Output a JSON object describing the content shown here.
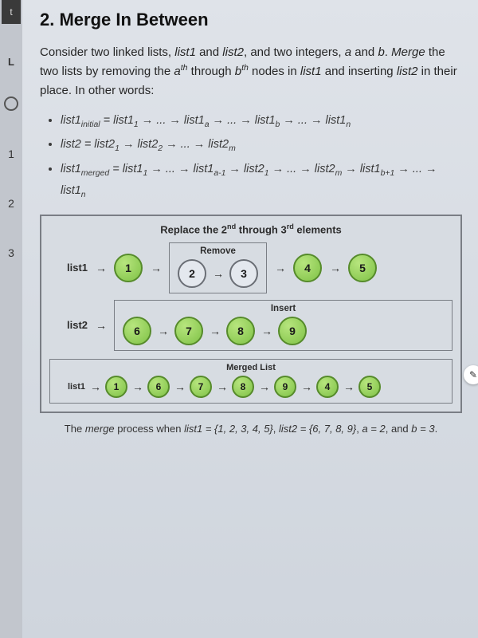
{
  "rail": {
    "tab": "t",
    "item_l": "L",
    "num1": "1",
    "num2": "2",
    "num3": "3"
  },
  "title": "2. Merge In Between",
  "intro": {
    "p1a": "Consider two linked lists, ",
    "list1": "list1",
    "p1b": " and ",
    "list2": "list2",
    "p1c": ", and two integers, ",
    "a": "a",
    "p1d": " and ",
    "b": "b",
    "p1e": ". ",
    "merge": "Merge",
    "p1f": " the two lists by removing the ",
    "ath": "a",
    "th1": "th",
    "p1g": " through ",
    "bth": "b",
    "th2": "th",
    "p1h": " nodes in ",
    "p1i": " and inserting ",
    "p1j": " in their place. In other words:"
  },
  "bullets": {
    "b1": "list1ᵢₙᵢₜᵢₐₗ = list1₁ → ... → list1ₐ → ... → list1_b → ... → list1ₙ",
    "b2": "list2 = list2₁ → list2₂ → ... → list2ₘ",
    "b3": "list1ₘₑᵣgₑd = list1₁ → ... → list1ₐ₋₁ → list2₁ → ... → list2ₘ → list1_b₊₁ → ... → list1ₙ"
  },
  "diagram": {
    "title_a": "Replace the 2",
    "title_nd": "nd",
    "title_b": " through 3",
    "title_rd": "rd",
    "title_c": " elements",
    "remove_label": "Remove",
    "insert_label": "Insert",
    "merged_label": "Merged List",
    "list1_label": "list1",
    "list2_label": "list2",
    "list1_nodes": [
      "1",
      "2",
      "3",
      "4",
      "5"
    ],
    "list2_nodes": [
      "6",
      "7",
      "8",
      "9"
    ],
    "merged_nodes": [
      "1",
      "6",
      "7",
      "8",
      "9",
      "4",
      "5"
    ]
  },
  "caption": {
    "a": "The ",
    "merge": "merge",
    "b": " process when ",
    "l1": "list1 = {1, 2, 3, 4, 5}",
    "c": ", ",
    "l2": "list2 = {6, 7, 8, 9}",
    "d": ", ",
    "av": "a = 2",
    "e": ", and ",
    "bv": "b = 3",
    "f": "."
  },
  "pencil_icon": "✎"
}
